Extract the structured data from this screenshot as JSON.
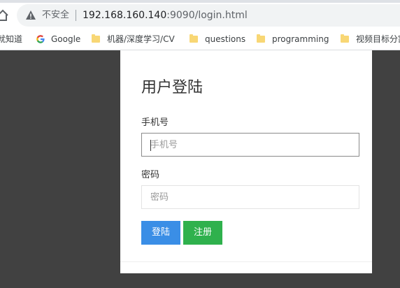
{
  "browser": {
    "insecure_label": "不安全",
    "url_host": "192.168.160.140",
    "url_rest": ":9090/login.html"
  },
  "bookmarks": [
    {
      "label": "就知道",
      "icon": "none"
    },
    {
      "label": "Google",
      "icon": "google-icon"
    },
    {
      "label": "机器/深度学习/CV",
      "icon": "folder-icon"
    },
    {
      "label": "questions",
      "icon": "folder-icon"
    },
    {
      "label": "programming",
      "icon": "folder-icon"
    },
    {
      "label": "视频目标分割",
      "icon": "folder-icon"
    }
  ],
  "login": {
    "title": "用户登陆",
    "phone_label": "手机号",
    "phone_placeholder": "手机号",
    "password_label": "密码",
    "password_placeholder": "密码",
    "login_button": "登陆",
    "register_button": "注册"
  },
  "colors": {
    "background": "#414141",
    "login_button": "#3a8ee6",
    "register_button": "#2fb14d"
  }
}
